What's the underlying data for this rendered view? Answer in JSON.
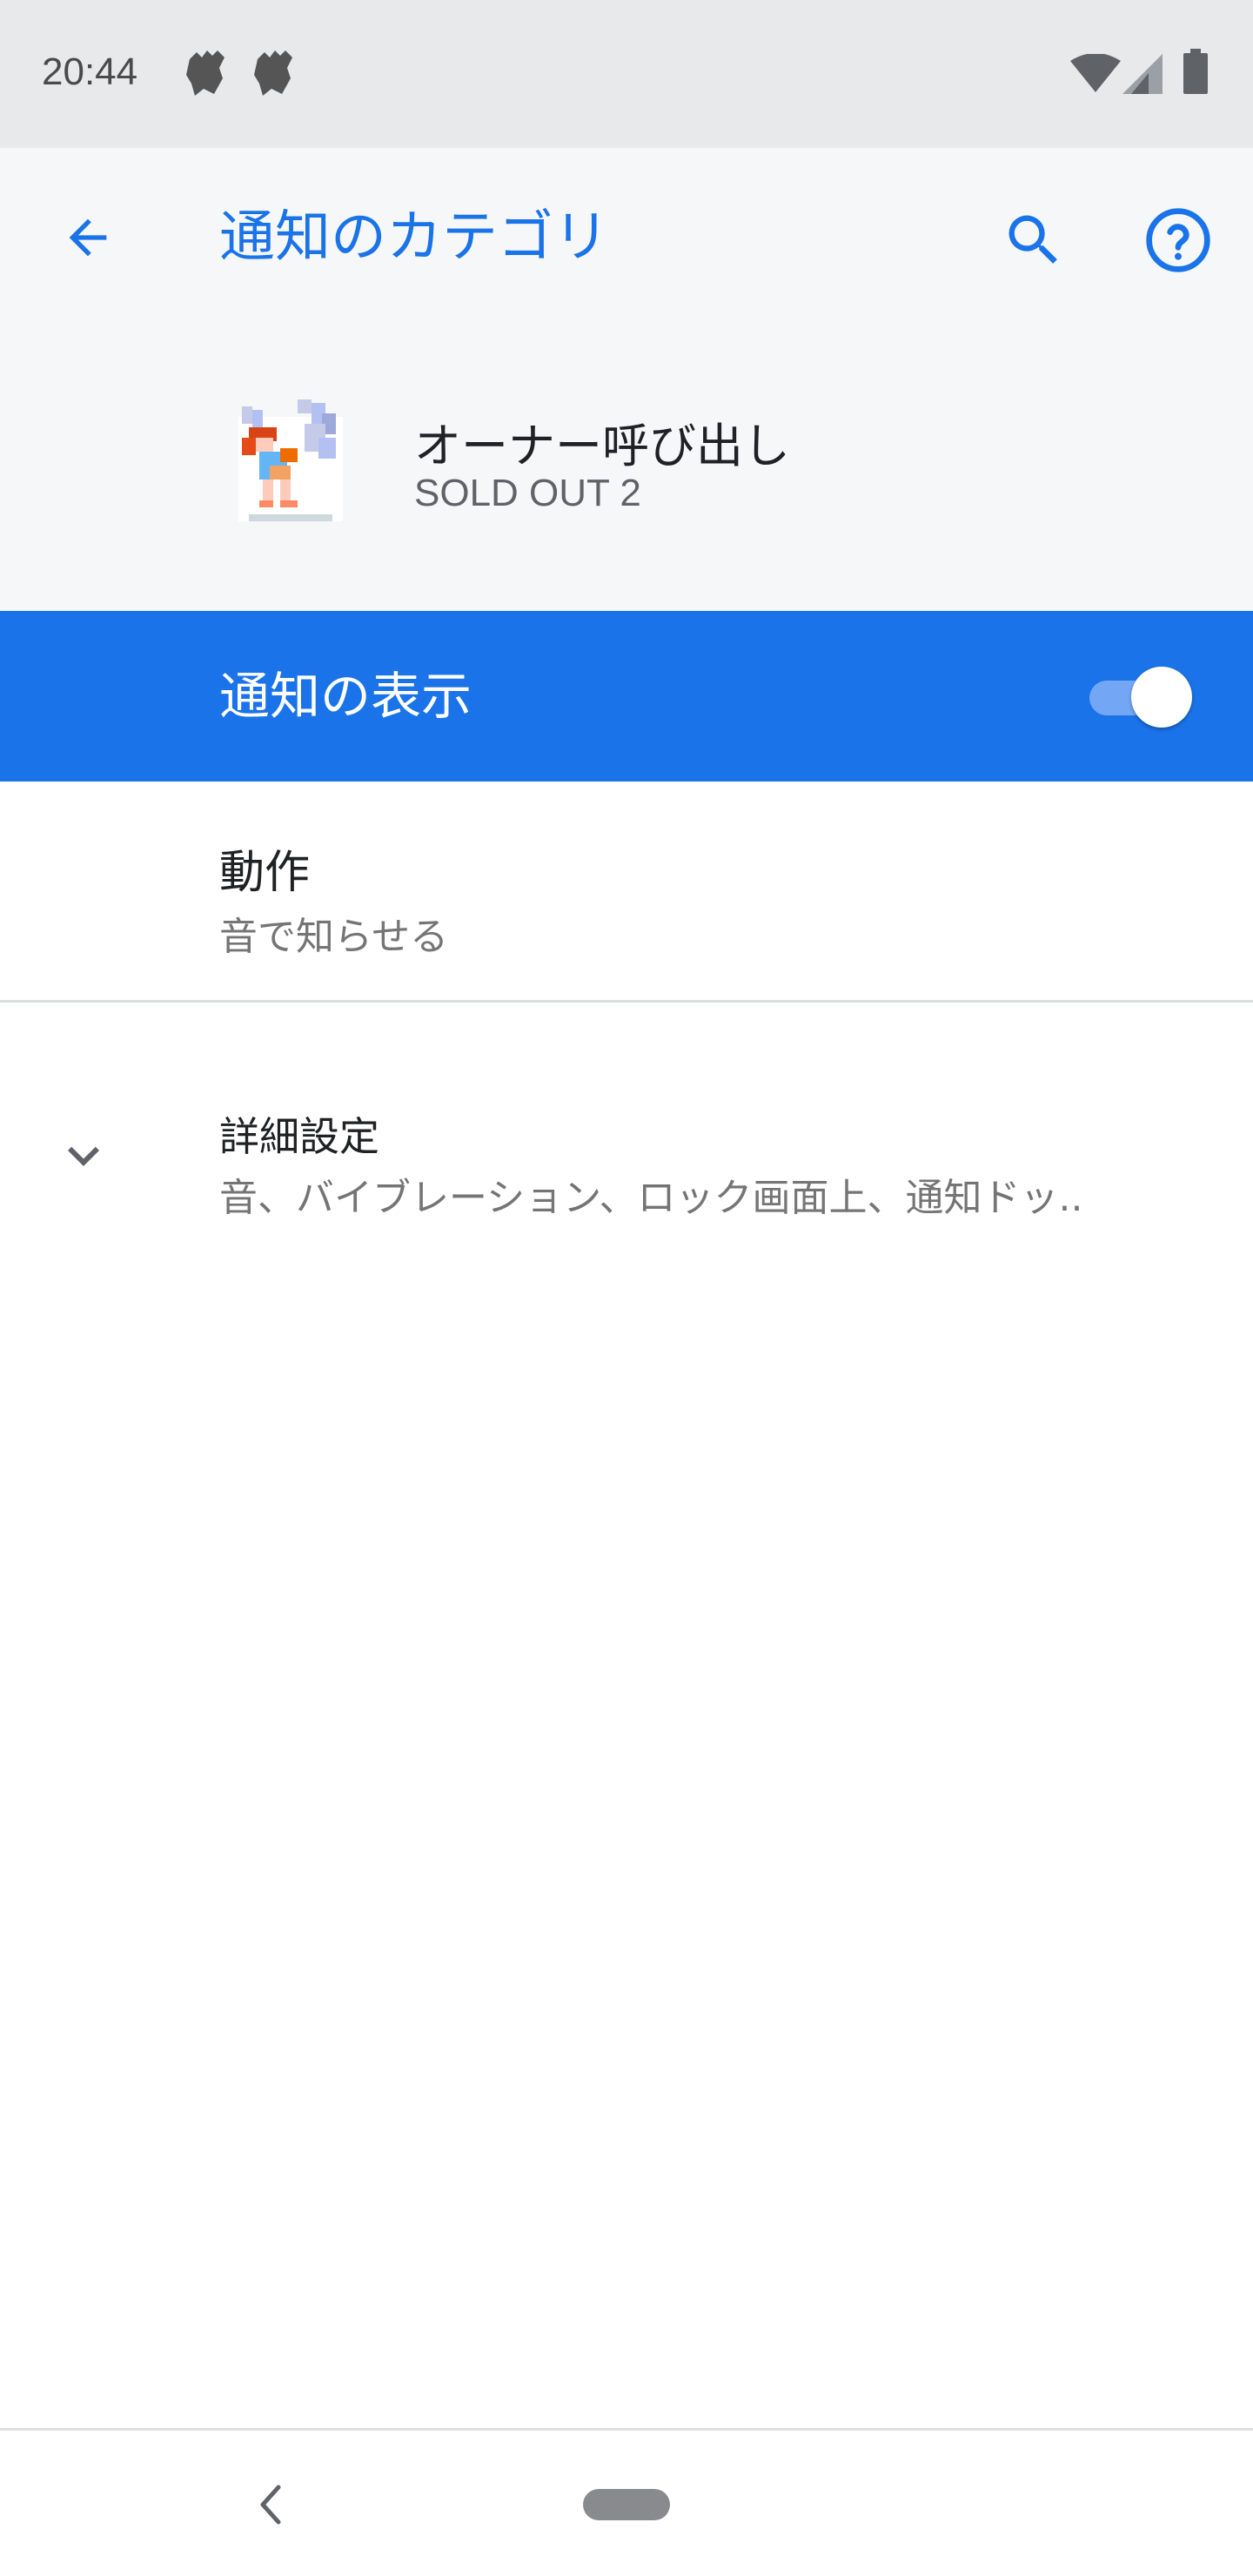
{
  "status_bar": {
    "time": "20:44",
    "notification_icons": [
      "fairy-app-icon",
      "fairy-app-icon"
    ],
    "right_icons": [
      "wifi-icon",
      "cellular-signal-icon",
      "battery-icon"
    ]
  },
  "app_bar": {
    "title": "通知のカテゴリ",
    "back_icon": "arrow-back-icon",
    "search_icon": "search-icon",
    "help_icon": "help-icon"
  },
  "header": {
    "channel_name": "オーナー呼び出し",
    "app_name": "SOLD OUT 2",
    "app_icon": "pixel-fairy-icon"
  },
  "show_notifications": {
    "label": "通知の表示",
    "enabled": true
  },
  "behavior": {
    "title": "動作",
    "value": "音で知らせる"
  },
  "advanced": {
    "title": "詳細設定",
    "summary": "音、バイブレーション、ロック画面上、通知ドッ..",
    "expand_icon": "chevron-down-icon"
  },
  "nav_bar": {
    "back_icon": "nav-back-icon",
    "home_icon": "home-pill"
  },
  "colors": {
    "accent": "#1a73e8",
    "status_bar_bg": "#e8e9eb",
    "header_bg": "#f6f7f9"
  }
}
